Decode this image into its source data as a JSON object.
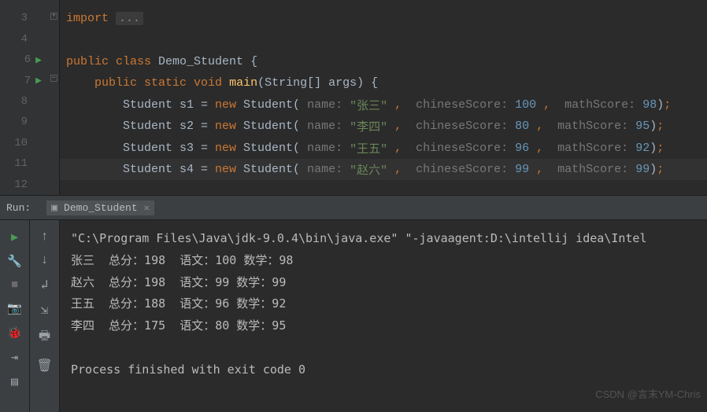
{
  "editor": {
    "lines": [
      {
        "no": "3",
        "fold": "expand",
        "code": [
          {
            "t": "import ",
            "c": "kw"
          },
          {
            "t": "...",
            "c": "fold-tag"
          }
        ]
      },
      {
        "no": "4",
        "code": []
      },
      {
        "no": "6",
        "run": true,
        "code": [
          {
            "t": "public ",
            "c": "kw"
          },
          {
            "t": "class ",
            "c": "kw"
          },
          {
            "t": "Demo_Student ",
            "c": "punc"
          },
          {
            "t": "{",
            "c": "punc"
          }
        ]
      },
      {
        "no": "7",
        "run": true,
        "fold": "collapse",
        "code": [
          {
            "t": "    ",
            "c": ""
          },
          {
            "t": "public ",
            "c": "kw"
          },
          {
            "t": "static ",
            "c": "kw"
          },
          {
            "t": "void ",
            "c": "kw"
          },
          {
            "t": "main",
            "c": "fn"
          },
          {
            "t": "(String[] args) {",
            "c": "punc"
          }
        ]
      },
      {
        "no": "8",
        "code": [
          {
            "t": "        Student s1 = ",
            "c": "punc"
          },
          {
            "t": "new ",
            "c": "kw"
          },
          {
            "t": "Student(",
            "c": "punc"
          },
          {
            "t": " name: ",
            "c": "hint"
          },
          {
            "t": "\"张三\" ",
            "c": "str"
          },
          {
            "t": ", ",
            "c": "sep"
          },
          {
            "t": " chineseScore: ",
            "c": "hint"
          },
          {
            "t": "100 ",
            "c": "num"
          },
          {
            "t": ", ",
            "c": "sep"
          },
          {
            "t": " mathScore: ",
            "c": "hint"
          },
          {
            "t": "98",
            "c": "num"
          },
          {
            "t": ")",
            "c": "punc"
          },
          {
            "t": ";",
            "c": "sep"
          }
        ]
      },
      {
        "no": "9",
        "code": [
          {
            "t": "        Student s2 = ",
            "c": "punc"
          },
          {
            "t": "new ",
            "c": "kw"
          },
          {
            "t": "Student(",
            "c": "punc"
          },
          {
            "t": " name: ",
            "c": "hint"
          },
          {
            "t": "\"李四\" ",
            "c": "str"
          },
          {
            "t": ", ",
            "c": "sep"
          },
          {
            "t": " chineseScore: ",
            "c": "hint"
          },
          {
            "t": "80 ",
            "c": "num"
          },
          {
            "t": ", ",
            "c": "sep"
          },
          {
            "t": " mathScore: ",
            "c": "hint"
          },
          {
            "t": "95",
            "c": "num"
          },
          {
            "t": ")",
            "c": "punc"
          },
          {
            "t": ";",
            "c": "sep"
          }
        ]
      },
      {
        "no": "10",
        "code": [
          {
            "t": "        Student s3 = ",
            "c": "punc"
          },
          {
            "t": "new ",
            "c": "kw"
          },
          {
            "t": "Student(",
            "c": "punc"
          },
          {
            "t": " name: ",
            "c": "hint"
          },
          {
            "t": "\"王五\" ",
            "c": "str"
          },
          {
            "t": ", ",
            "c": "sep"
          },
          {
            "t": " chineseScore: ",
            "c": "hint"
          },
          {
            "t": "96 ",
            "c": "num"
          },
          {
            "t": ", ",
            "c": "sep"
          },
          {
            "t": " mathScore: ",
            "c": "hint"
          },
          {
            "t": "92",
            "c": "num"
          },
          {
            "t": ")",
            "c": "punc"
          },
          {
            "t": ";",
            "c": "sep"
          }
        ]
      },
      {
        "no": "11",
        "hl": true,
        "code": [
          {
            "t": "        Student s4 = ",
            "c": "punc"
          },
          {
            "t": "new ",
            "c": "kw"
          },
          {
            "t": "Student(",
            "c": "punc"
          },
          {
            "t": " name: ",
            "c": "hint"
          },
          {
            "t": "\"赵六\" ",
            "c": "str"
          },
          {
            "t": ", ",
            "c": "sep"
          },
          {
            "t": " chineseScore: ",
            "c": "hint"
          },
          {
            "t": "99 ",
            "c": "num"
          },
          {
            "t": ", ",
            "c": "sep"
          },
          {
            "t": " mathScore: ",
            "c": "hint"
          },
          {
            "t": "99",
            "c": "num"
          },
          {
            "t": ")",
            "c": "punc"
          },
          {
            "t": ";",
            "c": "sep"
          }
        ]
      },
      {
        "no": "12",
        "code": []
      }
    ]
  },
  "run_panel": {
    "label": "Run:",
    "tab": "Demo_Student"
  },
  "console": {
    "cmd": "\"C:\\Program Files\\Java\\jdk-9.0.4\\bin\\java.exe\" \"-javaagent:D:\\intellij idea\\Intel",
    "rows": [
      "张三  总分：198  语文：100 数学：98",
      "赵六  总分：198  语文：99 数学：99",
      "王五  总分：188  语文：96 数学：92",
      "李四  总分：175  语文：80 数学：95"
    ],
    "exit": "Process finished with exit code 0"
  },
  "watermark": "CSDN @言末YM-Chris"
}
